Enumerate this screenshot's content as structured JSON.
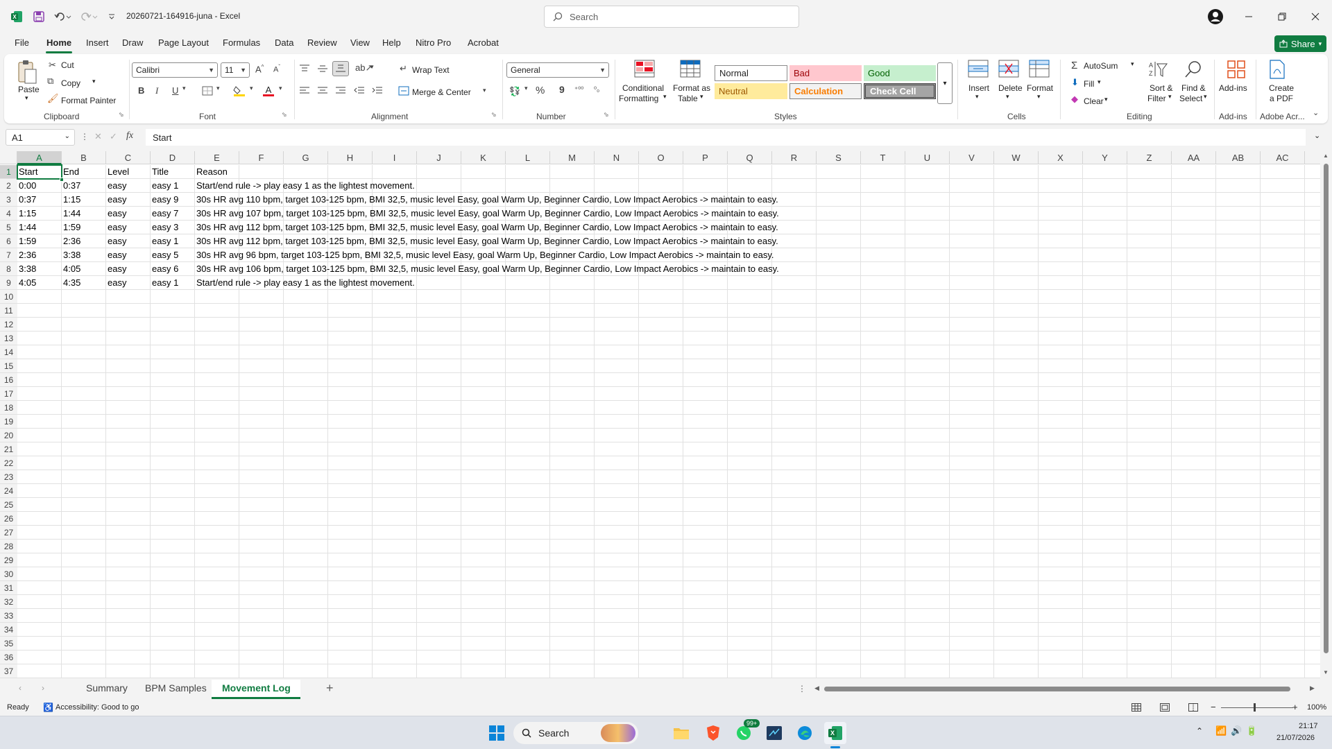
{
  "app": {
    "document_title": "20260721-164916-juna  -  Excel",
    "search_placeholder": "Search",
    "share_label": "Share"
  },
  "menu": {
    "tabs": [
      "File",
      "Home",
      "Insert",
      "Draw",
      "Page Layout",
      "Formulas",
      "Data",
      "Review",
      "View",
      "Help",
      "Nitro Pro",
      "Acrobat"
    ],
    "active": "Home"
  },
  "ribbon": {
    "clipboard": {
      "paste": "Paste",
      "cut": "Cut",
      "copy": "Copy",
      "format_painter": "Format Painter",
      "group": "Clipboard"
    },
    "font": {
      "name": "Calibri",
      "size": "11",
      "group": "Font",
      "bold": "B",
      "italic": "I",
      "underline": "U"
    },
    "alignment": {
      "wrap_text": "Wrap Text",
      "merge_center": "Merge & Center",
      "group": "Alignment"
    },
    "number": {
      "format": "General",
      "percent": "%",
      "comma": "9",
      "group": "Number"
    },
    "styles": {
      "conditional_formatting_1": "Conditional",
      "conditional_formatting_2": "Formatting",
      "format_as_table_1": "Format as",
      "format_as_table_2": "Table",
      "normal": "Normal",
      "bad": "Bad",
      "good": "Good",
      "neutral": "Neutral",
      "calculation": "Calculation",
      "check_cell": "Check Cell",
      "group": "Styles"
    },
    "cells": {
      "insert": "Insert",
      "delete": "Delete",
      "format": "Format",
      "group": "Cells"
    },
    "editing": {
      "autosum": "AutoSum",
      "fill": "Fill",
      "clear": "Clear",
      "sort_filter_1": "Sort &",
      "sort_filter_2": "Filter",
      "find_select_1": "Find &",
      "find_select_2": "Select",
      "group": "Editing"
    },
    "addins": {
      "label": "Add-ins",
      "group": "Add-ins"
    },
    "adobe": {
      "create_pdf_1": "Create",
      "create_pdf_2": "a PDF",
      "group": "Adobe Acr..."
    }
  },
  "formula_bar": {
    "name_box": "A1",
    "formula": "Start"
  },
  "columns": [
    "A",
    "B",
    "C",
    "D",
    "E",
    "F",
    "G",
    "H",
    "I",
    "J",
    "K",
    "L",
    "M",
    "N",
    "O",
    "P",
    "Q",
    "R",
    "S",
    "T",
    "U",
    "V",
    "W",
    "X",
    "Y",
    "Z",
    "AA",
    "AB",
    "AC"
  ],
  "row_numbers": [
    "1",
    "2",
    "3",
    "4",
    "5",
    "6",
    "7",
    "8",
    "9",
    "10",
    "11",
    "12",
    "13",
    "14",
    "15",
    "16",
    "17",
    "18",
    "19",
    "20",
    "21",
    "22",
    "23",
    "24",
    "25",
    "26",
    "27",
    "28",
    "29",
    "30",
    "31",
    "32",
    "33",
    "34",
    "35",
    "36",
    "37"
  ],
  "sheet": {
    "headers": [
      "Start",
      "End",
      "Level",
      "Title",
      "Reason"
    ],
    "rows": [
      [
        "0:00",
        "0:37",
        "easy",
        "easy 1",
        "Start/end rule -> play easy 1 as the lightest movement."
      ],
      [
        "0:37",
        "1:15",
        "easy",
        "easy 9",
        "30s HR avg 110 bpm, target 103-125 bpm, BMI 32,5, music level Easy, goal Warm Up, Beginner Cardio, Low Impact Aerobics -> maintain to easy."
      ],
      [
        "1:15",
        "1:44",
        "easy",
        "easy 7",
        "30s HR avg 107 bpm, target 103-125 bpm, BMI 32,5, music level Easy, goal Warm Up, Beginner Cardio, Low Impact Aerobics -> maintain to easy."
      ],
      [
        "1:44",
        "1:59",
        "easy",
        "easy 3",
        "30s HR avg 112 bpm, target 103-125 bpm, BMI 32,5, music level Easy, goal Warm Up, Beginner Cardio, Low Impact Aerobics -> maintain to easy."
      ],
      [
        "1:59",
        "2:36",
        "easy",
        "easy 1",
        "30s HR avg 112 bpm, target 103-125 bpm, BMI 32,5, music level Easy, goal Warm Up, Beginner Cardio, Low Impact Aerobics -> maintain to easy."
      ],
      [
        "2:36",
        "3:38",
        "easy",
        "easy 5",
        "30s HR avg 96 bpm, target 103-125 bpm, BMI 32,5, music level Easy, goal Warm Up, Beginner Cardio, Low Impact Aerobics -> maintain to easy."
      ],
      [
        "3:38",
        "4:05",
        "easy",
        "easy 6",
        "30s HR avg 106 bpm, target 103-125 bpm, BMI 32,5, music level Easy, goal Warm Up, Beginner Cardio, Low Impact Aerobics -> maintain to easy."
      ],
      [
        "4:05",
        "4:35",
        "easy",
        "easy 1",
        "Start/end rule -> play easy 1 as the lightest movement."
      ]
    ]
  },
  "sheet_tabs": [
    "Summary",
    "BPM Samples",
    "Movement Log"
  ],
  "active_sheet": "Movement Log",
  "status": {
    "ready": "Ready",
    "accessibility": "Accessibility: Good to go",
    "zoom": "100%"
  },
  "taskbar": {
    "search": "Search",
    "time": "21:17",
    "date": "21/07/2026",
    "badge": "99+"
  },
  "colors": {
    "excel_green": "#107c41",
    "bad_fill": "#ffc7ce",
    "good_fill": "#c6efce",
    "neutral_fill": "#ffeb9c",
    "check_cell_fill": "#a5a5a5",
    "calc_fill": "#f2f2f2"
  }
}
